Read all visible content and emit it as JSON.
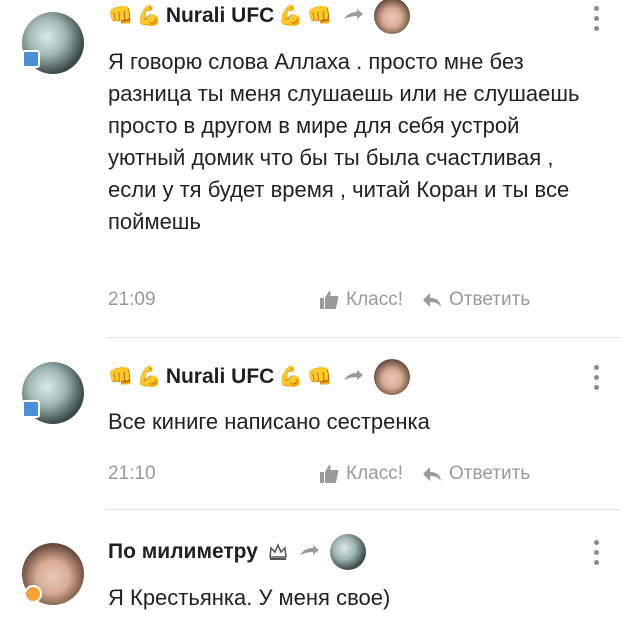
{
  "comments": [
    {
      "author": "Nurali UFC",
      "text": "Я говорю слова Аллаха  . просто мне без разница ты меня слушаешь или не слушаешь просто в другом в мире для себя устрой уютный домик что бы ты была счастливая , если у тя будет время , читай Коран и ты все поймешь",
      "time": "21:09",
      "like_label": "Класс!",
      "reply_label": "Ответить",
      "avatar_icon": "wave-avatar",
      "reply_to_avatar": "girl-avatar"
    },
    {
      "author": "Nurali UFC",
      "text": "Все киниге написано сестренка",
      "time": "21:10",
      "like_label": "Класс!",
      "reply_label": "Ответить",
      "avatar_icon": "wave-avatar",
      "reply_to_avatar": "girl-avatar"
    },
    {
      "author": "По милиметру",
      "text": "Я Крестьянка. У меня свое)",
      "avatar_icon": "girl-avatar",
      "reply_to_avatar": "wave-avatar"
    }
  ],
  "emojis": {
    "fist": "👊",
    "arm": "💪"
  },
  "colors": {
    "meta_text": "#9a9a9a",
    "author_text": "#1f1f1f",
    "divider": "#e3e3e3"
  }
}
